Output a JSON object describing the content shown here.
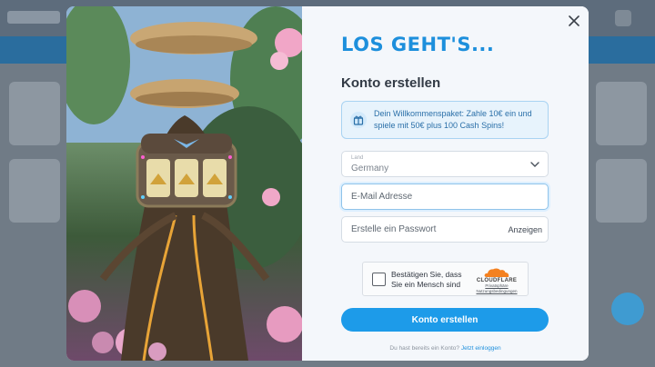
{
  "modal": {
    "headline": "LOS GEHT'S...",
    "title": "Konto erstellen",
    "promo_text": "Dein Willkommenspaket: Zahle 10€ ein und spiele mit 50€ plus 100 Cash Spins!",
    "promo_icon": "gift-badge-icon",
    "country": {
      "label": "Land",
      "value": "Germany"
    },
    "email": {
      "placeholder": "E-Mail Adresse",
      "value": ""
    },
    "password": {
      "placeholder": "Erstelle ein Passwort",
      "value": "",
      "toggle_label": "Anzeigen"
    },
    "captcha": {
      "text": "Bestätigen Sie, dass Sie ein Mensch sind",
      "brand": "CLOUDFLARE",
      "privacy_link": "Privatsphäre",
      "terms_link": "Nutzungsbedingungen"
    },
    "submit_label": "Konto erstellen",
    "login_prompt": "Du hast bereits ein Konto?",
    "login_link": "Jetzt einloggen"
  },
  "colors": {
    "accent": "#1d9be9",
    "headline": "#1d8fdc",
    "promo_bg": "#e7f3fc",
    "cloudflare_orange": "#f48120"
  }
}
